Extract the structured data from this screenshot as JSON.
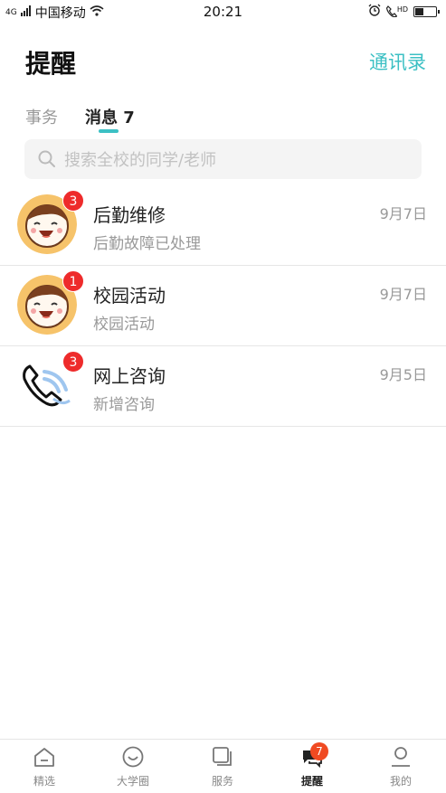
{
  "status_bar": {
    "carrier": "中国移动",
    "time": "20:21",
    "network": "4G",
    "hd": "HD"
  },
  "header": {
    "title": "提醒",
    "contacts_label": "通讯录"
  },
  "tabs": [
    {
      "label": "事务",
      "active": false
    },
    {
      "label": "消息 7",
      "active": true
    }
  ],
  "search": {
    "placeholder": "搜索全校的同学/老师",
    "icon": "search-icon"
  },
  "messages": [
    {
      "title": "后勤维修",
      "subtitle": "后勤故障已处理",
      "date": "9月7日",
      "badge": "3",
      "avatar": "smiley-face"
    },
    {
      "title": "校园活动",
      "subtitle": "校园活动",
      "date": "9月7日",
      "badge": "1",
      "avatar": "smiley-face"
    },
    {
      "title": "网上咨询",
      "subtitle": "新增咨询",
      "date": "9月5日",
      "badge": "3",
      "avatar": "phone-icon"
    }
  ],
  "tabbar": [
    {
      "label": "精选",
      "icon": "home-icon",
      "active": false
    },
    {
      "label": "大学圈",
      "icon": "smile-icon",
      "active": false
    },
    {
      "label": "服务",
      "icon": "pages-icon",
      "active": false
    },
    {
      "label": "提醒",
      "icon": "chat-icon",
      "active": true,
      "badge": "7"
    },
    {
      "label": "我的",
      "icon": "person-icon",
      "active": false
    }
  ],
  "colors": {
    "accent": "#3cc0c4",
    "badge": "#ee2b2b",
    "tab_badge": "#f04a22"
  }
}
